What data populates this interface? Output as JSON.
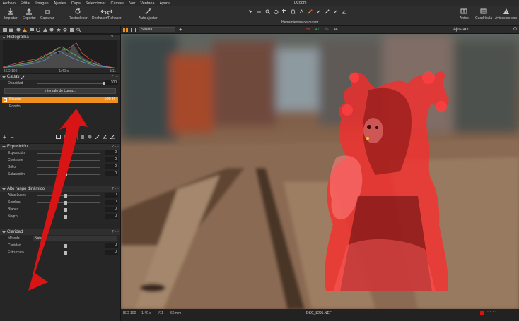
{
  "menu": {
    "items": [
      "Archivo",
      "Editar",
      "Imagen",
      "Ajustes",
      "Capa",
      "Seleccionar",
      "Cámara",
      "Ver",
      "Ventana",
      "Ayuda"
    ],
    "window_title": "Dzoom"
  },
  "toolbar": {
    "importar": "Importar",
    "exportar": "Exportar",
    "capturar": "Capturar",
    "restablecer": "Restablecer",
    "deshacer": "Deshacer/Rehacer",
    "auto": "Auto ajustar",
    "cursor_tools": "Herramientas de cursor",
    "antes": "Antes",
    "cuadricula": "Cuadrícula",
    "avisos": "Avisos de exp"
  },
  "histogram": {
    "title": "Histograma",
    "iso": "ISO 100",
    "shutter": "1/40 s",
    "aperture": "f/11"
  },
  "layers": {
    "title": "Capas",
    "opacity_label": "Opacidad",
    "opacity_value": "100",
    "luma_button": "Intervalo de Luma...",
    "items": [
      {
        "name": "Silueta",
        "opacity": "100 %"
      },
      {
        "name": "Fondo"
      }
    ]
  },
  "exposure": {
    "title": "Exposición",
    "rows": [
      {
        "label": "Exposición",
        "value": "0",
        "level": 0.45
      },
      {
        "label": "Contraste",
        "value": "0",
        "level": 0.45
      },
      {
        "label": "Brillo",
        "value": "0",
        "level": 0.45
      },
      {
        "label": "Saturación",
        "value": "0",
        "level": 0.45
      }
    ]
  },
  "hdr": {
    "title": "Alto rango dinámico",
    "rows": [
      {
        "label": "Altas Luces",
        "value": "0",
        "level": 0.45
      },
      {
        "label": "Sombra",
        "value": "0",
        "level": 0.45
      },
      {
        "label": "Blanco",
        "value": "0",
        "level": 0.45
      },
      {
        "label": "Negro",
        "value": "0",
        "level": 0.45
      }
    ]
  },
  "clarity": {
    "title": "Claridad",
    "method_label": "Método",
    "method_value": "Natural",
    "rows": [
      {
        "label": "Claridad",
        "value": "0",
        "level": 0.45
      },
      {
        "label": "Estructura",
        "value": "0",
        "level": 0.45
      }
    ]
  },
  "viewer": {
    "layer_select": "Silueta",
    "readouts": [
      "58",
      "47",
      "36",
      "46"
    ],
    "fit": "Ajustar",
    "status_iso": "ISO 100",
    "status_shutter": "1/40 s",
    "status_aperture": "f/11",
    "status_focal": "60 mm",
    "filename": "DSC_8295.NEF"
  },
  "colors": {
    "accent": "#f0901c",
    "mask": "#ff2a2a",
    "arrow": "#d81414"
  }
}
